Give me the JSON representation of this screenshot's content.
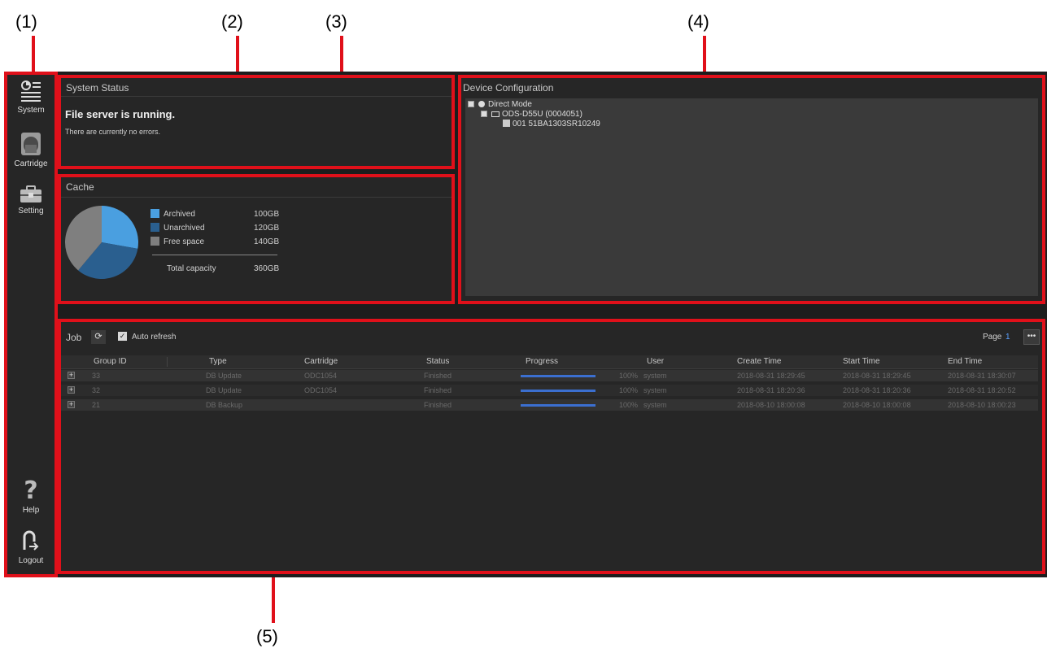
{
  "callouts": [
    "(1)",
    "(2)",
    "(3)",
    "(4)",
    "(5)"
  ],
  "sidebar": {
    "items": [
      {
        "label": "System",
        "icon": "system-icon"
      },
      {
        "label": "Cartridge",
        "icon": "cartridge-icon"
      },
      {
        "label": "Setting",
        "icon": "setting-icon"
      },
      {
        "label": "Help",
        "icon": "help-icon"
      },
      {
        "label": "Logout",
        "icon": "logout-icon"
      }
    ]
  },
  "system_status": {
    "title": "System Status",
    "headline": "File server is running.",
    "message": "There are currently no errors."
  },
  "cache": {
    "title": "Cache",
    "legend": [
      {
        "label": "Archived",
        "value": "100GB",
        "color": "#4a9fe0"
      },
      {
        "label": "Unarchived",
        "value": "120GB",
        "color": "#2a5f8f"
      },
      {
        "label": "Free space",
        "value": "140GB",
        "color": "#7f7f7f"
      }
    ],
    "total_label": "Total capacity",
    "total_value": "360GB",
    "chart_data": {
      "type": "pie",
      "categories": [
        "Archived",
        "Unarchived",
        "Free space"
      ],
      "values": [
        100,
        120,
        140
      ]
    }
  },
  "device_config": {
    "title": "Device Configuration",
    "nodes": [
      "Direct Mode",
      "ODS-D55U (0004051)",
      "001 51BA1303SR10249"
    ]
  },
  "job": {
    "title": "Job",
    "auto_refresh": "Auto refresh",
    "page_label": "Page",
    "page_number": "1",
    "columns": [
      "Group ID",
      "Type",
      "Cartridge",
      "Status",
      "Progress",
      "User",
      "Create Time",
      "Start Time",
      "End Time"
    ],
    "rows": [
      {
        "group_id": "33",
        "type": "DB Update",
        "cartridge": "ODC1054",
        "status": "Finished",
        "progress": "100%",
        "user": "system",
        "create": "2018-08-31 18:29:45",
        "start": "2018-08-31 18:29:45",
        "end": "2018-08-31 18:30:07"
      },
      {
        "group_id": "32",
        "type": "DB Update",
        "cartridge": "ODC1054",
        "status": "Finished",
        "progress": "100%",
        "user": "system",
        "create": "2018-08-31 18:20:36",
        "start": "2018-08-31 18:20:36",
        "end": "2018-08-31 18:20:52"
      },
      {
        "group_id": "21",
        "type": "DB Backup",
        "cartridge": "",
        "status": "Finished",
        "progress": "100%",
        "user": "system",
        "create": "2018-08-10 18:00:08",
        "start": "2018-08-10 18:00:08",
        "end": "2018-08-10 18:00:23"
      }
    ]
  },
  "colors": {
    "callout_red": "#e0101a",
    "progress_blue": "#3b6fd0",
    "background": "#1d1d1d"
  }
}
